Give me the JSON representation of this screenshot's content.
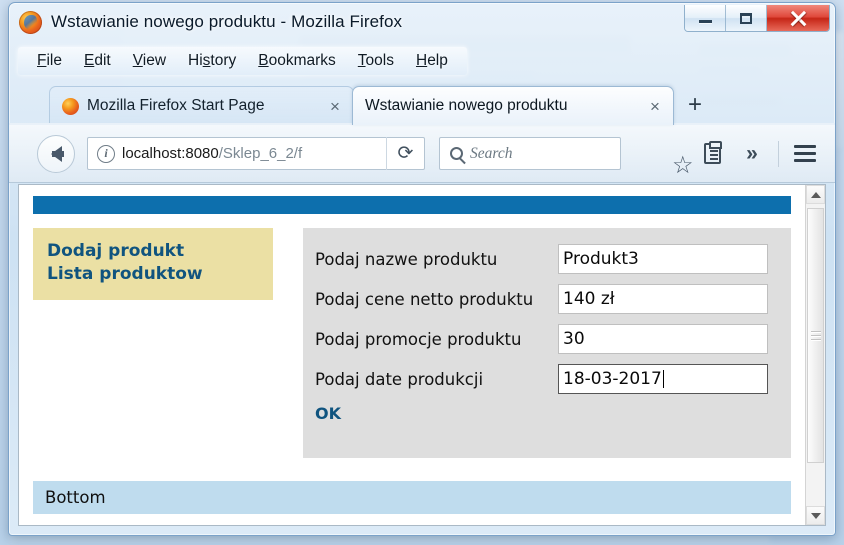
{
  "window": {
    "title": "Wstawianie nowego produktu - Mozilla Firefox",
    "logo_icon": "firefox-logo-icon",
    "controls": {
      "minimize": "minimize-icon",
      "maximize": "restore-icon",
      "close": "close-icon"
    }
  },
  "menubar": {
    "items": [
      {
        "label": "File",
        "accel": "F"
      },
      {
        "label": "Edit",
        "accel": "E"
      },
      {
        "label": "View",
        "accel": "V"
      },
      {
        "label": "History",
        "accel": "s"
      },
      {
        "label": "Bookmarks",
        "accel": "B"
      },
      {
        "label": "Tools",
        "accel": "T"
      },
      {
        "label": "Help",
        "accel": "H"
      }
    ]
  },
  "tabs": [
    {
      "label": "Mozilla Firefox Start Page",
      "close": "×",
      "active": false
    },
    {
      "label": "Wstawianie nowego produktu",
      "close": "×",
      "active": true
    }
  ],
  "new_tab_label": "+",
  "navbar": {
    "back_icon": "back-arrow-icon",
    "identity_icon": "i",
    "url_host": "localhost:8080",
    "url_path": "/Sklep_6_2/f",
    "url_full": "localhost:8080/Sklep_6_2/f",
    "reload_icon": "⟳",
    "search_placeholder": "Search",
    "bookmark_icon": "☆",
    "library_icon": "library-icon",
    "overflow_icon": "»",
    "menu_icon": "hamburger-menu-icon"
  },
  "page": {
    "sidebar_links": [
      "Dodaj produkt",
      "Lista produktow"
    ],
    "form_rows": [
      {
        "label": "Podaj nazwe produktu",
        "value": "Produkt3",
        "focused": false
      },
      {
        "label": "Podaj cene netto produktu",
        "value": "140 zł",
        "focused": false
      },
      {
        "label": "Podaj promocje produktu",
        "value": "30",
        "focused": false
      },
      {
        "label": "Podaj date produkcji",
        "value": "18-03-2017",
        "focused": true
      }
    ],
    "submit_label": "OK",
    "bottom_label": "Bottom"
  },
  "scrollbar": {
    "up_icon": "scroll-up-icon",
    "down_icon": "scroll-down-icon"
  },
  "colors": {
    "page_header_blue": "#0d6fad",
    "sidebar_khaki": "#ebe0a4",
    "link_blue": "#10547f",
    "form_panel_gray": "#dedede",
    "bottom_blue": "#bfdcee",
    "close_red": "#c62617"
  }
}
